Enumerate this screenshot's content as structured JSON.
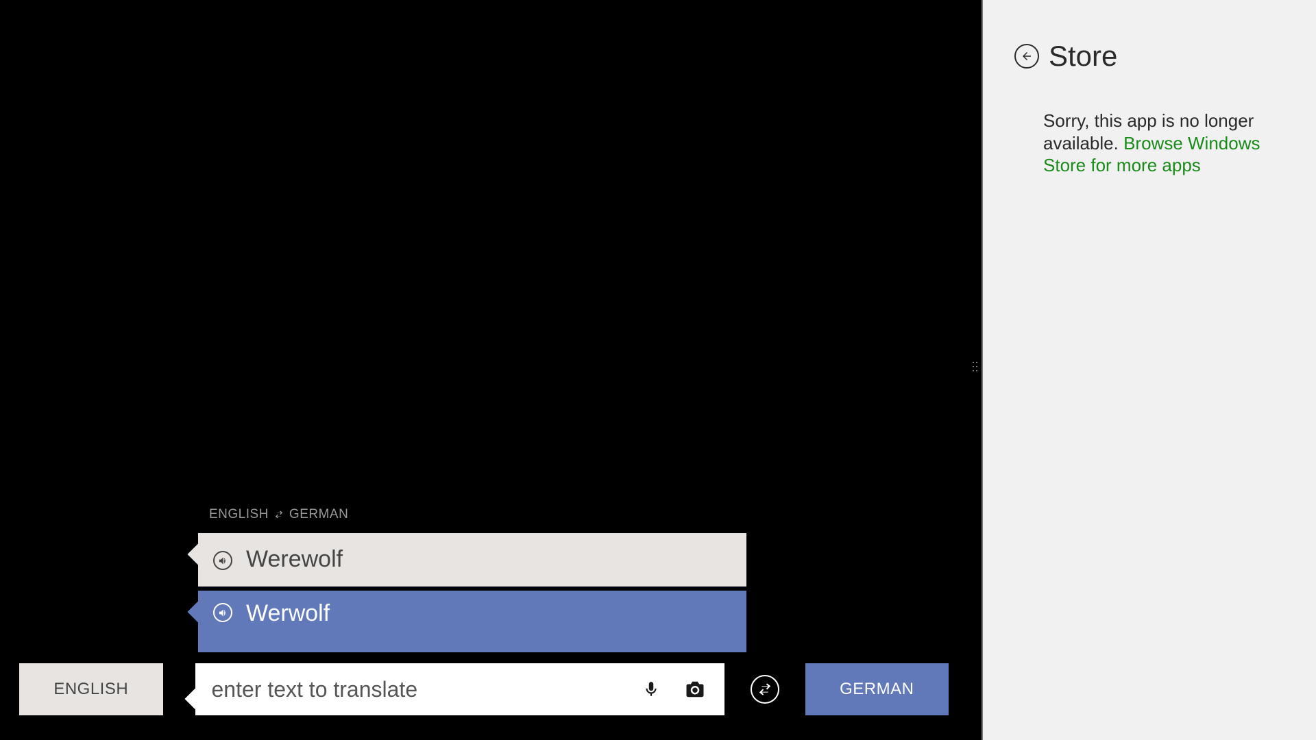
{
  "translator": {
    "direction": {
      "from": "ENGLISH",
      "to": "GERMAN"
    },
    "source_text": "Werewolf",
    "target_text": "Werwolf",
    "input_placeholder": "enter text to translate",
    "source_lang_button": "ENGLISH",
    "target_lang_button": "GERMAN"
  },
  "store": {
    "title": "Store",
    "message_prefix": "Sorry, this app is no longer available. ",
    "link_text": "Browse Windows Store for more apps"
  },
  "colors": {
    "accent": "#6179b8",
    "link": "#1a8a1a",
    "panel_light": "#e8e4e1"
  }
}
